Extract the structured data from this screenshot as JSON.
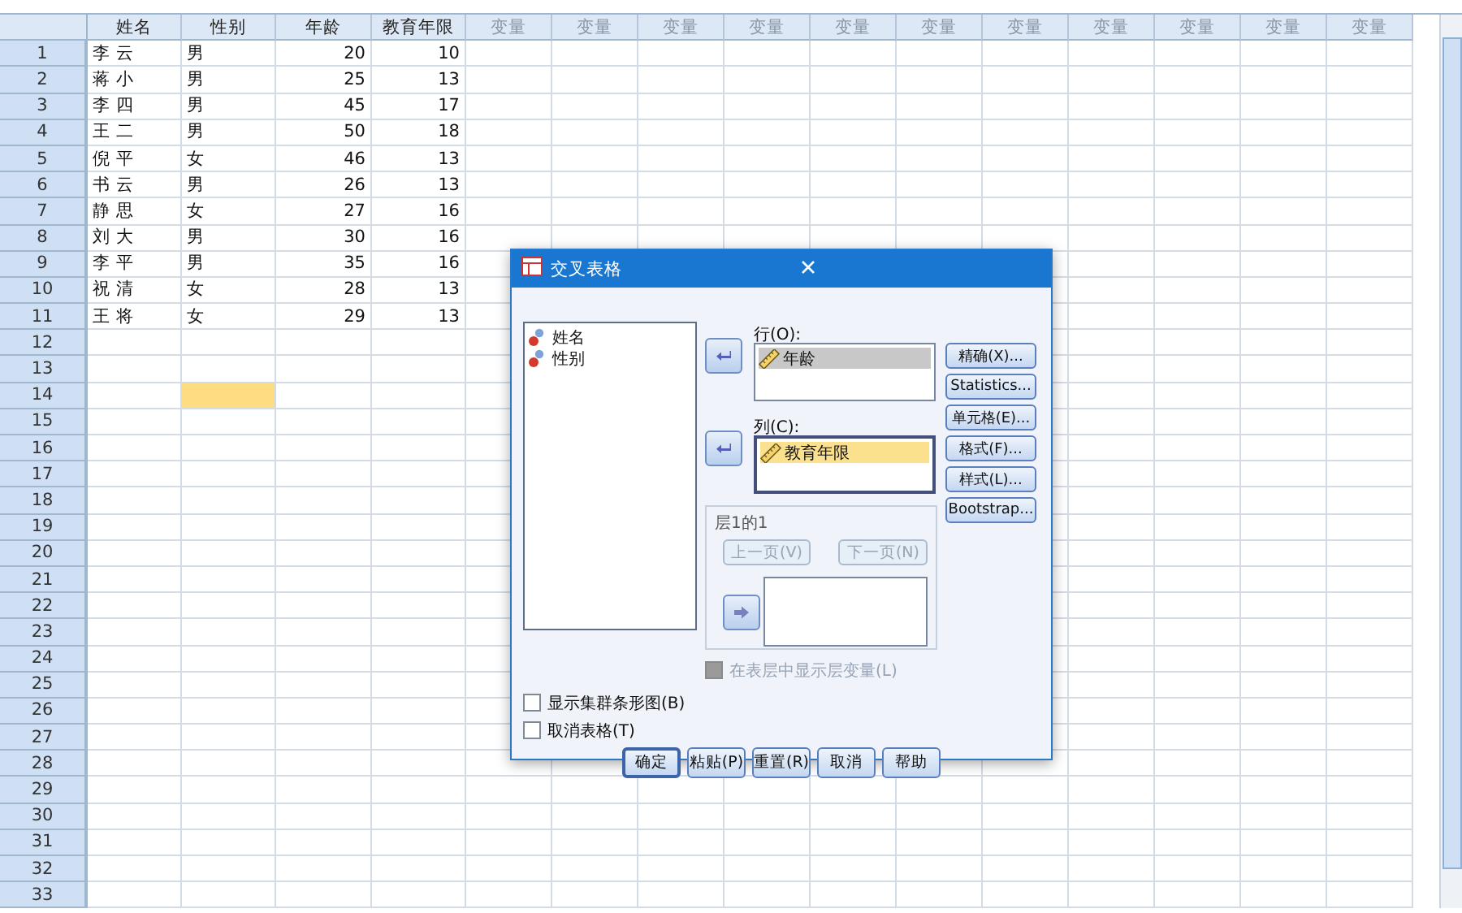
{
  "data_view": {
    "columns": [
      {
        "label": "姓名",
        "kind": "string"
      },
      {
        "label": "性别",
        "kind": "string"
      },
      {
        "label": "年龄",
        "kind": "numeric"
      },
      {
        "label": "教育年限",
        "kind": "numeric"
      },
      {
        "label": "变量",
        "kind": "empty"
      },
      {
        "label": "变量",
        "kind": "empty"
      },
      {
        "label": "变量",
        "kind": "empty"
      },
      {
        "label": "变量",
        "kind": "empty"
      },
      {
        "label": "变量",
        "kind": "empty"
      },
      {
        "label": "变量",
        "kind": "empty"
      },
      {
        "label": "变量",
        "kind": "empty"
      },
      {
        "label": "变量",
        "kind": "empty"
      },
      {
        "label": "变量",
        "kind": "empty"
      },
      {
        "label": "变量",
        "kind": "empty"
      },
      {
        "label": "变量",
        "kind": "empty"
      }
    ],
    "rows": [
      {
        "number": "1",
        "cells": [
          "李 云",
          "男",
          "20",
          "10"
        ],
        "selected": [
          false,
          false,
          false,
          false
        ]
      },
      {
        "number": "2",
        "cells": [
          "蒋 小",
          "男",
          "25",
          "13"
        ],
        "selected": [
          false,
          false,
          false,
          false
        ]
      },
      {
        "number": "3",
        "cells": [
          "李 四",
          "男",
          "45",
          "17"
        ],
        "selected": [
          false,
          false,
          false,
          false
        ]
      },
      {
        "number": "4",
        "cells": [
          "王 二",
          "男",
          "50",
          "18"
        ],
        "selected": [
          false,
          false,
          false,
          false
        ]
      },
      {
        "number": "5",
        "cells": [
          "倪 平",
          "女",
          "46",
          "13"
        ],
        "selected": [
          false,
          false,
          false,
          false
        ]
      },
      {
        "number": "6",
        "cells": [
          "书 云",
          "男",
          "26",
          "13"
        ],
        "selected": [
          false,
          false,
          false,
          false
        ]
      },
      {
        "number": "7",
        "cells": [
          "静 思",
          "女",
          "27",
          "16"
        ],
        "selected": [
          false,
          false,
          false,
          false
        ]
      },
      {
        "number": "8",
        "cells": [
          "刘 大",
          "男",
          "30",
          "16"
        ],
        "selected": [
          false,
          false,
          false,
          false
        ]
      },
      {
        "number": "9",
        "cells": [
          "李 平",
          "男",
          "35",
          "16"
        ],
        "selected": [
          false,
          false,
          false,
          false
        ]
      },
      {
        "number": "10",
        "cells": [
          "祝 清",
          "女",
          "28",
          "13"
        ],
        "selected": [
          false,
          false,
          false,
          false
        ]
      },
      {
        "number": "11",
        "cells": [
          "王 将",
          "女",
          "29",
          "13"
        ],
        "selected": [
          false,
          false,
          false,
          false
        ]
      },
      {
        "number": "12",
        "selected": [
          false,
          false,
          false,
          false
        ]
      },
      {
        "number": "13",
        "selected": [
          false,
          false,
          false,
          false
        ]
      },
      {
        "number": "14",
        "selected": [
          false,
          true,
          false,
          false
        ]
      },
      {
        "number": "15",
        "selected": [
          false,
          false,
          false,
          false
        ]
      },
      {
        "number": "16",
        "selected": [
          false,
          false,
          false,
          false
        ]
      },
      {
        "number": "17",
        "selected": [
          false,
          false,
          false,
          false
        ]
      },
      {
        "number": "18",
        "selected": [
          false,
          false,
          false,
          false
        ]
      },
      {
        "number": "19",
        "selected": [
          false,
          false,
          false,
          false
        ]
      },
      {
        "number": "20",
        "selected": [
          false,
          false,
          false,
          false
        ]
      },
      {
        "number": "21",
        "selected": [
          false,
          false,
          false,
          false
        ]
      },
      {
        "number": "22",
        "selected": [
          false,
          false,
          false,
          false
        ]
      },
      {
        "number": "23",
        "selected": [
          false,
          false,
          false,
          false
        ]
      },
      {
        "number": "24",
        "selected": [
          false,
          false,
          false,
          false
        ]
      },
      {
        "number": "25",
        "selected": [
          false,
          false,
          false,
          false
        ]
      },
      {
        "number": "26",
        "selected": [
          false,
          false,
          false,
          false
        ]
      },
      {
        "number": "27",
        "selected": [
          false,
          false,
          false,
          false
        ]
      },
      {
        "number": "28",
        "selected": [
          false,
          false,
          false,
          false
        ]
      },
      {
        "number": "29",
        "selected": [
          false,
          false,
          false,
          false
        ]
      },
      {
        "number": "30",
        "selected": [
          false,
          false,
          false,
          false
        ]
      },
      {
        "number": "31",
        "selected": [
          false,
          false,
          false,
          false
        ]
      },
      {
        "number": "32",
        "selected": [
          false,
          false,
          false,
          false
        ]
      },
      {
        "number": "33",
        "selected": [
          false,
          false,
          false,
          false
        ]
      }
    ]
  },
  "dialog": {
    "title": "交叉表格",
    "source_list": [
      {
        "label": "姓名",
        "kind": "nominal"
      },
      {
        "label": "性别",
        "kind": "nominal"
      }
    ],
    "row_box": {
      "label": "行(O):",
      "focused": false,
      "items": [
        {
          "label": "年龄",
          "kind": "scale",
          "selected": true
        }
      ]
    },
    "column_box": {
      "label": "列(C):",
      "focused": true,
      "items": [
        {
          "label": "教育年限",
          "kind": "scale",
          "selected": true
        }
      ]
    },
    "layer": {
      "title": "层1的1",
      "prev": {
        "label": "上一页(V)",
        "disabled": true
      },
      "next": {
        "label": "下一页(N)",
        "disabled": true
      }
    },
    "layer_option": {
      "label": "在表层中显示层变量(L)",
      "checked": false,
      "disabled": true
    },
    "side_buttons": [
      "精确(X)...",
      "Statistics...",
      "单元格(E)...",
      "格式(F)...",
      "样式(L)...",
      "Bootstrap..."
    ],
    "options": [
      {
        "label": "显示集群条形图(B)",
        "checked": false
      },
      {
        "label": "取消表格(T)",
        "checked": false
      }
    ],
    "buttons": [
      "确定",
      "粘贴(P)",
      "重置(R)",
      "取消",
      "帮助"
    ]
  }
}
